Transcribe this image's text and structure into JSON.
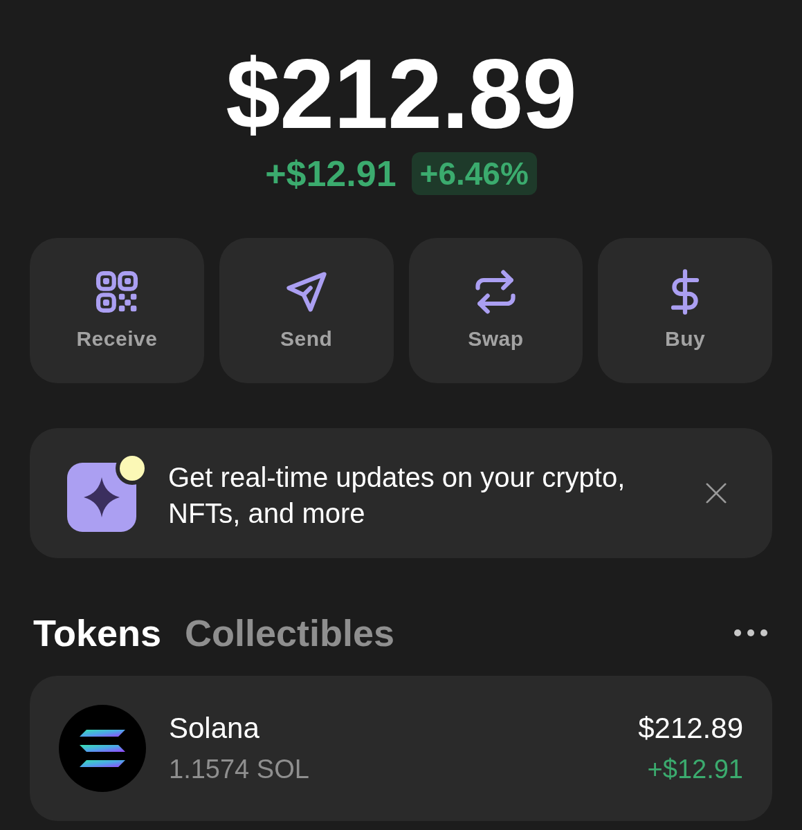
{
  "balance": {
    "total": "$212.89",
    "change_amount": "+$12.91",
    "change_percent": "+6.46%",
    "positive": true
  },
  "actions": [
    {
      "label": "Receive",
      "kind": "receive"
    },
    {
      "label": "Send",
      "kind": "send"
    },
    {
      "label": "Swap",
      "kind": "swap"
    },
    {
      "label": "Buy",
      "kind": "buy"
    }
  ],
  "banner": {
    "text": "Get real-time updates on your crypto, NFTs, and more"
  },
  "tabs": [
    {
      "label": "Tokens",
      "selected": true
    },
    {
      "label": "Collectibles",
      "selected": false
    }
  ],
  "tokens": [
    {
      "name": "Solana",
      "amount": "1.1574 SOL",
      "value": "$212.89",
      "change": "+$12.91",
      "positive": true
    }
  ]
}
